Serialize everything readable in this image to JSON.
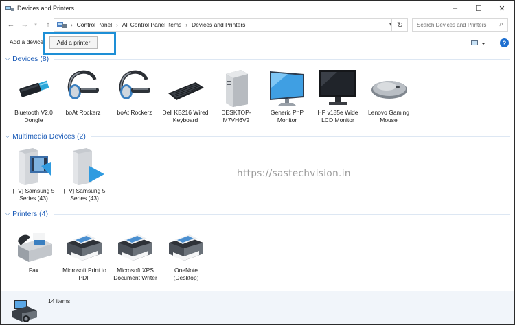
{
  "window": {
    "title": "Devices and Printers",
    "minimize": "–",
    "maximize": "☐",
    "close": "✕"
  },
  "address": {
    "breadcrumbs": [
      "Control Panel",
      "All Control Panel Items",
      "Devices and Printers"
    ],
    "search_placeholder": "Search Devices and Printers"
  },
  "toolbar": {
    "add_device": "Add a device",
    "add_printer": "Add a printer",
    "help": "?"
  },
  "groups": {
    "devices": {
      "title": "Devices (8)",
      "items": [
        {
          "label": "Bluetooth V2.0 Dongle",
          "icon": "usb-dongle-icon"
        },
        {
          "label": "boAt Rockerz",
          "icon": "headset-icon"
        },
        {
          "label": "boAt Rockerz",
          "icon": "headset-icon"
        },
        {
          "label": "Dell KB216 Wired Keyboard",
          "icon": "keyboard-icon"
        },
        {
          "label": "DESKTOP-M7VH6V2",
          "icon": "desktop-tower-icon"
        },
        {
          "label": "Generic PnP Monitor",
          "icon": "monitor-icon"
        },
        {
          "label": "HP v185e Wide LCD Monitor",
          "icon": "lcd-monitor-icon"
        },
        {
          "label": "Lenovo Gaming Mouse",
          "icon": "mouse-icon"
        }
      ]
    },
    "multimedia": {
      "title": "Multimedia Devices (2)",
      "items": [
        {
          "label": "[TV] Samsung 5 Series (43)",
          "icon": "media-server-icon"
        },
        {
          "label": "[TV] Samsung 5 Series (43)",
          "icon": "media-renderer-icon"
        }
      ]
    },
    "printers": {
      "title": "Printers (4)",
      "items": [
        {
          "label": "Fax",
          "icon": "fax-icon"
        },
        {
          "label": "Microsoft Print to PDF",
          "icon": "printer-icon"
        },
        {
          "label": "Microsoft XPS Document Writer",
          "icon": "printer-icon"
        },
        {
          "label": "OneNote (Desktop)",
          "icon": "printer-icon"
        }
      ]
    }
  },
  "watermark": "https://sastechvision.in",
  "status": {
    "count": "14 items"
  },
  "colors": {
    "group_title": "#1c5cb8",
    "highlight": "#1e8fd6",
    "status_bg": "#f1f5fa"
  }
}
